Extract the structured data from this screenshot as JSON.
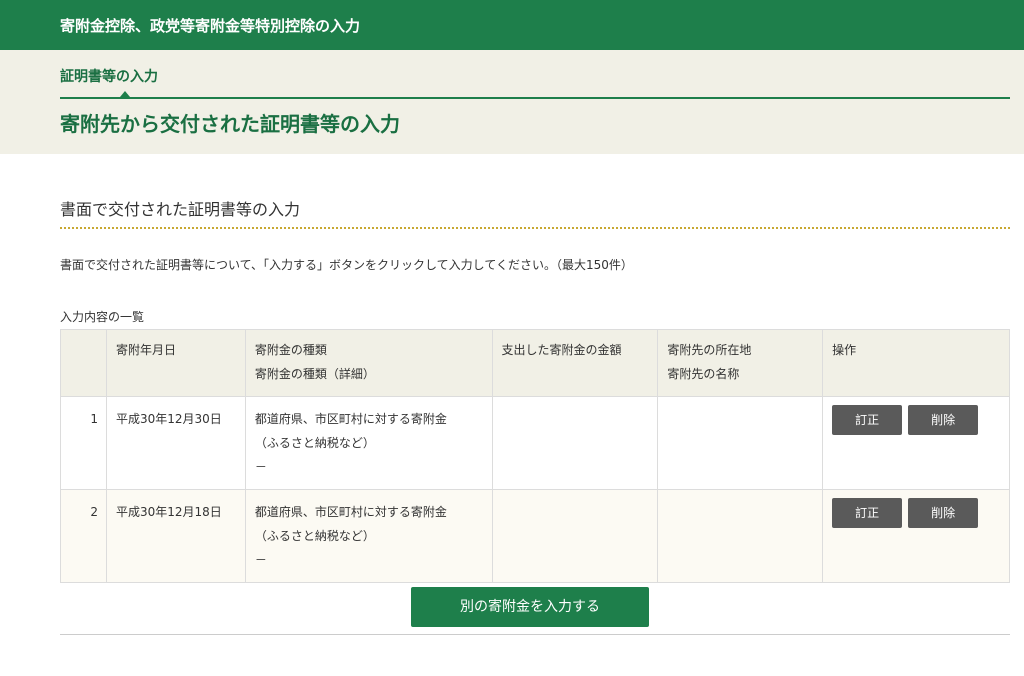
{
  "topbar": {
    "title": "寄附金控除、政党等寄附金等特別控除の入力"
  },
  "header": {
    "step_label": "証明書等の入力",
    "page_title": "寄附先から交付された証明書等の入力"
  },
  "section": {
    "title": "書面で交付された証明書等の入力",
    "instruction": "書面で交付された証明書等について、「入力する」ボタンをクリックして入力してください。（最大150件）",
    "list_caption": "入力内容の一覧"
  },
  "table": {
    "headers": {
      "date": "寄附年月日",
      "type": "寄附金の種類",
      "type_detail": "寄附金の種類（詳細）",
      "amount": "支出した寄附金の金額",
      "location": "寄附先の所在地",
      "name": "寄附先の名称",
      "ops": "操作"
    },
    "rows": [
      {
        "num": "1",
        "date": "平成30年12月30日",
        "type_line1": "都道府県、市区町村に対する寄附金",
        "type_line2": "（ふるさと納税など）",
        "detail": "－",
        "amount": "",
        "location": "",
        "edit": "訂正",
        "delete": "削除"
      },
      {
        "num": "2",
        "date": "平成30年12月18日",
        "type_line1": "都道府県、市区町村に対する寄附金",
        "type_line2": "（ふるさと納税など）",
        "detail": "－",
        "amount": "",
        "location": "",
        "edit": "訂正",
        "delete": "削除"
      }
    ]
  },
  "actions": {
    "add_another": "別の寄附金を入力する"
  },
  "colors": {
    "brand_green": "#1e7f4b",
    "band_beige": "#f1f0e6",
    "button_gray": "#5a5a5a"
  }
}
